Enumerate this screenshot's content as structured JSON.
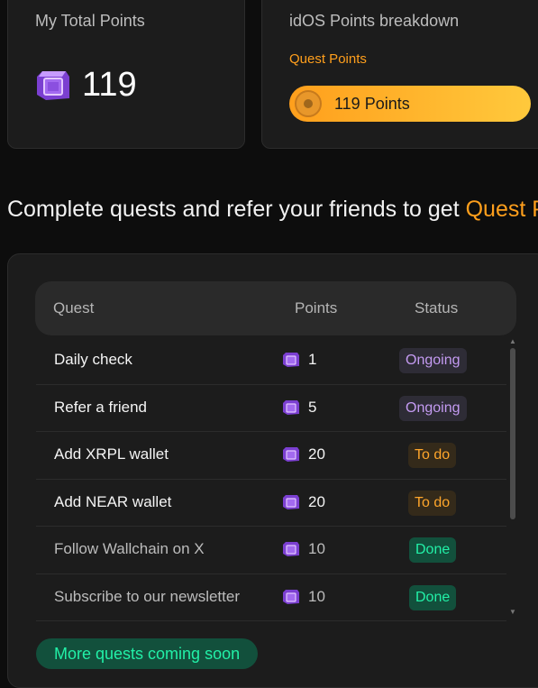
{
  "total_card": {
    "title": "My Total Points",
    "value": "119"
  },
  "breakdown_card": {
    "title": "idOS Points breakdown",
    "quest_points_label": "Quest Points",
    "bar_label": "119 Points"
  },
  "headline": {
    "text": "Complete quests and refer your friends to get ",
    "accent": "Quest P"
  },
  "table": {
    "headers": {
      "quest": "Quest",
      "points": "Points",
      "status": "Status"
    },
    "rows": [
      {
        "quest": "Daily check",
        "points": "1",
        "status": "Ongoing"
      },
      {
        "quest": "Refer a friend",
        "points": "5",
        "status": "Ongoing"
      },
      {
        "quest": "Add XRPL wallet",
        "points": "20",
        "status": "To do"
      },
      {
        "quest": "Add NEAR wallet",
        "points": "20",
        "status": "To do"
      },
      {
        "quest": "Follow Wallchain on X",
        "points": "10",
        "status": "Done"
      },
      {
        "quest": "Subscribe to our newsletter",
        "points": "10",
        "status": "Done"
      }
    ]
  },
  "more_quests": "More quests coming soon",
  "colors": {
    "accent_orange": "#ff9f1c",
    "ongoing_text": "#c49bf2",
    "todo_text": "#ffa62b",
    "done_text": "#22f0a7",
    "points_icon": "#9b5de5"
  },
  "icons": {
    "points": "purple-cube-icon",
    "coin": "coin-icon"
  }
}
